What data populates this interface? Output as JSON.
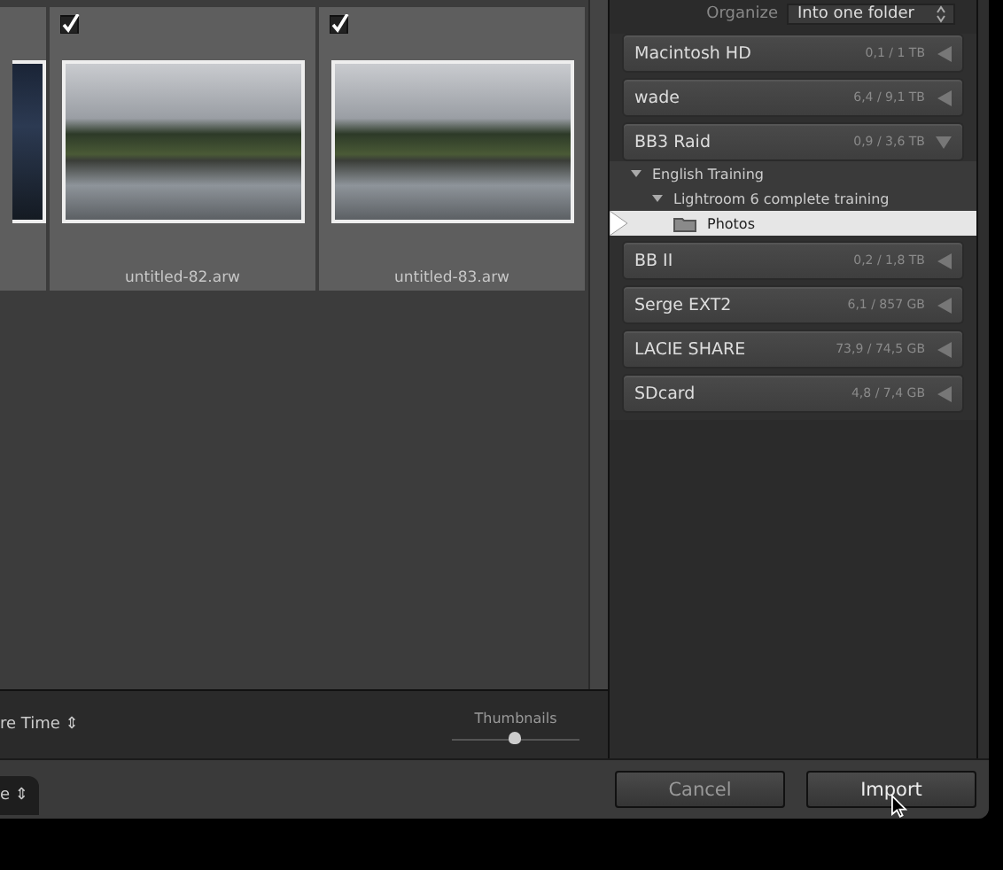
{
  "grid": {
    "cells": [
      {
        "kind": "partial"
      },
      {
        "kind": "full",
        "checked": true,
        "filename": "untitled-82.arw"
      },
      {
        "kind": "full",
        "checked": true,
        "filename": "untitled-83.arw"
      }
    ]
  },
  "toolbar": {
    "sort_label": "re Time",
    "sort_arrows": "⇕",
    "thumbnails_label": "Thumbnails",
    "thumbnails_slider": {
      "level": 0.49
    }
  },
  "destination": {
    "organize_label": "Organize",
    "organize_value": "Into one folder",
    "volumes": [
      {
        "name": "Macintosh HD",
        "size": "0,1 / 1 TB",
        "expanded": false
      },
      {
        "name": "wade",
        "size": "6,4 / 9,1 TB",
        "expanded": false
      },
      {
        "name": "BB3 Raid",
        "size": "0,9 / 3,6 TB",
        "expanded": true,
        "children": [
          {
            "label": "English Training",
            "expanded": true,
            "selected": false,
            "children": [
              {
                "label": "Lightroom 6 complete training",
                "expanded": true,
                "selected": false,
                "children": [
                  {
                    "label": "Photos",
                    "selected": true
                  }
                ]
              }
            ]
          }
        ]
      },
      {
        "name": "BB II",
        "size": "0,2 / 1,8 TB",
        "expanded": false
      },
      {
        "name": "Serge EXT2",
        "size": "6,1 / 857 GB",
        "expanded": false
      },
      {
        "name": "LACIE SHARE",
        "size": "73,9 / 74,5 GB",
        "expanded": false
      },
      {
        "name": "SDcard",
        "size": "4,8 / 7,4 GB",
        "expanded": false
      }
    ]
  },
  "footer": {
    "left_tab": "e",
    "left_tab_arrows": "⇕",
    "buttons": [
      {
        "label": "Cancel",
        "kind": "secondary"
      },
      {
        "label": "Import",
        "kind": "primary"
      }
    ]
  }
}
